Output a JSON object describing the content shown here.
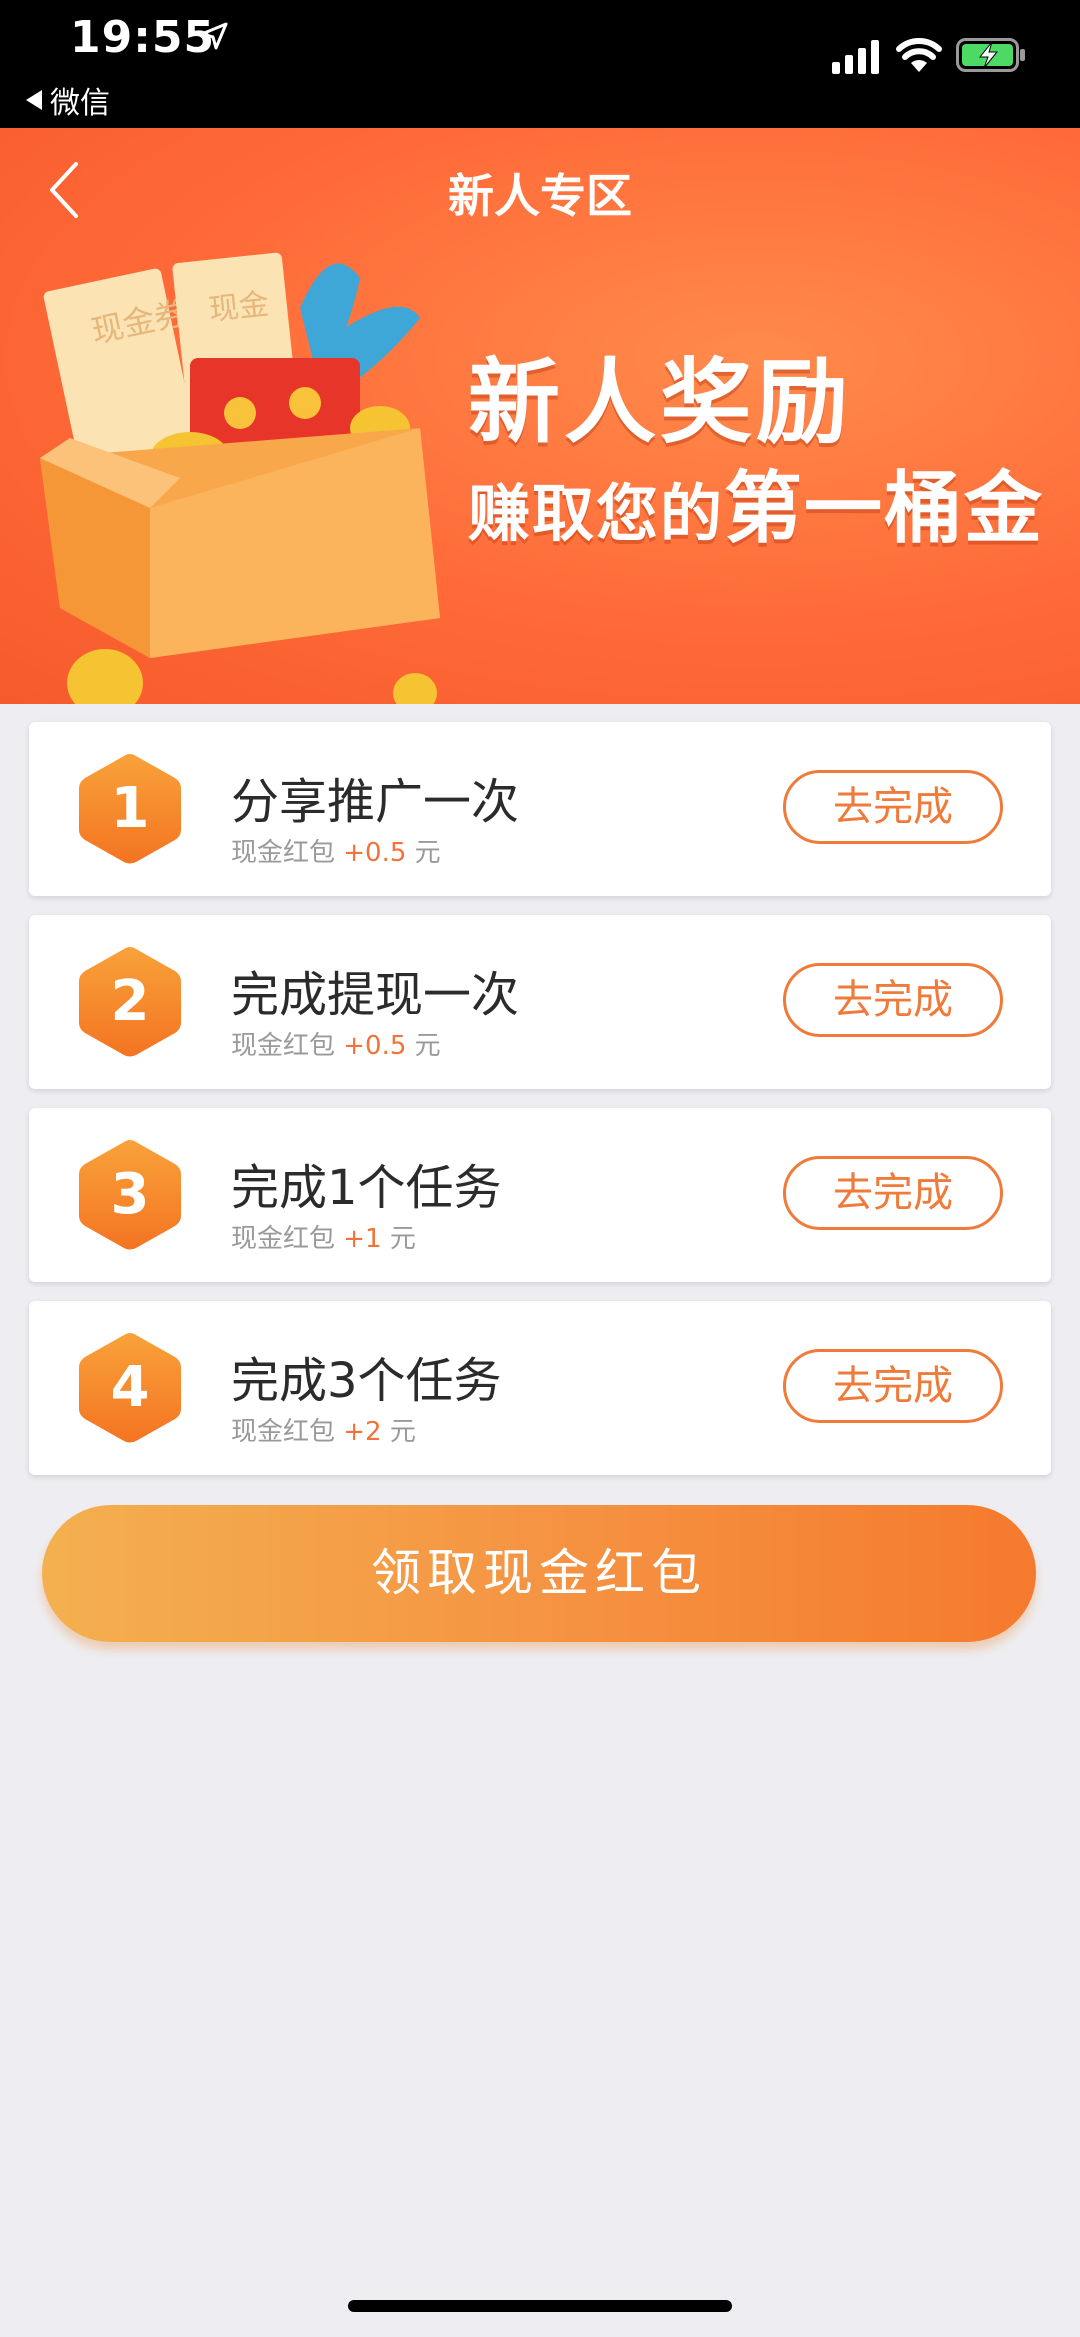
{
  "status_bar": {
    "time": "19:55",
    "back_app_label": "微信"
  },
  "header": {
    "title": "新人专区"
  },
  "banner": {
    "headline": "新人奖励",
    "subline_prefix": "赚取您的",
    "subline_emph": "第一桶金",
    "art_text_1": "现金券",
    "art_text_2": "现金"
  },
  "tasks": [
    {
      "number": "1",
      "title": "分享推广一次",
      "reward_label": "现金红包",
      "reward_amount": "+0.5",
      "reward_unit": "元",
      "action": "去完成"
    },
    {
      "number": "2",
      "title": "完成提现一次",
      "reward_label": "现金红包",
      "reward_amount": "+0.5",
      "reward_unit": "元",
      "action": "去完成"
    },
    {
      "number": "3",
      "title": "完成1个任务",
      "reward_label": "现金红包",
      "reward_amount": "+1",
      "reward_unit": "元",
      "action": "去完成"
    },
    {
      "number": "4",
      "title": "完成3个任务",
      "reward_label": "现金红包",
      "reward_amount": "+2",
      "reward_unit": "元",
      "action": "去完成"
    }
  ],
  "claim_button": "领取现金红包",
  "colors": {
    "accent": "#ef7a3a",
    "banner": "#ff6a38",
    "hex_top": "#f8a23a",
    "hex_bottom": "#f47422"
  },
  "icons": [
    "location-arrow-icon",
    "signal-icon",
    "wifi-icon",
    "battery-charging-icon",
    "back-chevron-icon"
  ]
}
